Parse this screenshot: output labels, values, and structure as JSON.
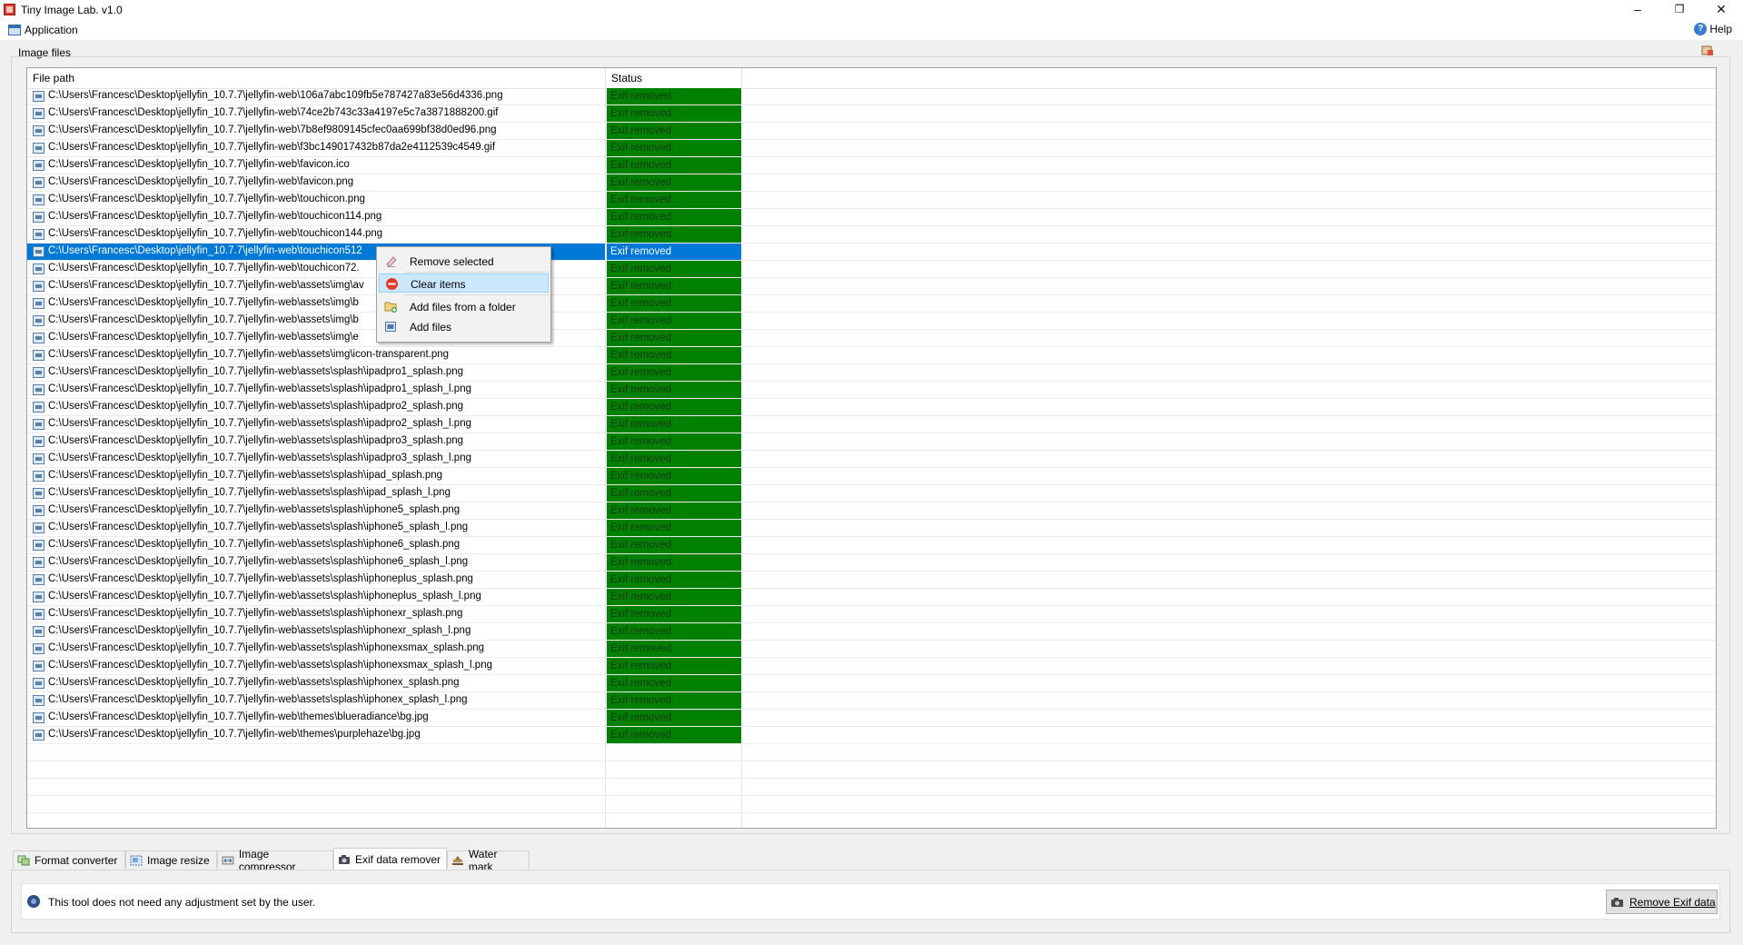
{
  "window": {
    "title": "Tiny Image Lab. v1.0",
    "minimize": "–",
    "maximize": "❐",
    "close": "✕"
  },
  "menubar": {
    "application": "Application",
    "help": "Help",
    "help_glyph": "?"
  },
  "group_label": "Image files",
  "table": {
    "columns": [
      "File path",
      "Status"
    ],
    "selected_index": 9,
    "rows": [
      {
        "path": "C:\\Users\\Francesc\\Desktop\\jellyfin_10.7.7\\jellyfin-web\\106a7abc109fb5e787427a83e56d4336.png",
        "status": "Exif removed"
      },
      {
        "path": "C:\\Users\\Francesc\\Desktop\\jellyfin_10.7.7\\jellyfin-web\\74ce2b743c33a4197e5c7a3871888200.gif",
        "status": "Exif removed"
      },
      {
        "path": "C:\\Users\\Francesc\\Desktop\\jellyfin_10.7.7\\jellyfin-web\\7b8ef9809145cfec0aa699bf38d0ed96.png",
        "status": "Exif removed"
      },
      {
        "path": "C:\\Users\\Francesc\\Desktop\\jellyfin_10.7.7\\jellyfin-web\\f3bc149017432b87da2e4112539c4549.gif",
        "status": "Exif removed"
      },
      {
        "path": "C:\\Users\\Francesc\\Desktop\\jellyfin_10.7.7\\jellyfin-web\\favicon.ico",
        "status": "Exif removed"
      },
      {
        "path": "C:\\Users\\Francesc\\Desktop\\jellyfin_10.7.7\\jellyfin-web\\favicon.png",
        "status": "Exif removed"
      },
      {
        "path": "C:\\Users\\Francesc\\Desktop\\jellyfin_10.7.7\\jellyfin-web\\touchicon.png",
        "status": "Exif removed"
      },
      {
        "path": "C:\\Users\\Francesc\\Desktop\\jellyfin_10.7.7\\jellyfin-web\\touchicon114.png",
        "status": "Exif removed"
      },
      {
        "path": "C:\\Users\\Francesc\\Desktop\\jellyfin_10.7.7\\jellyfin-web\\touchicon144.png",
        "status": "Exif removed"
      },
      {
        "path": "C:\\Users\\Francesc\\Desktop\\jellyfin_10.7.7\\jellyfin-web\\touchicon512",
        "status": "Exif removed"
      },
      {
        "path": "C:\\Users\\Francesc\\Desktop\\jellyfin_10.7.7\\jellyfin-web\\touchicon72.",
        "status": "Exif removed"
      },
      {
        "path": "C:\\Users\\Francesc\\Desktop\\jellyfin_10.7.7\\jellyfin-web\\assets\\img\\av",
        "status": "Exif removed"
      },
      {
        "path": "C:\\Users\\Francesc\\Desktop\\jellyfin_10.7.7\\jellyfin-web\\assets\\img\\b",
        "status": "Exif removed"
      },
      {
        "path": "C:\\Users\\Francesc\\Desktop\\jellyfin_10.7.7\\jellyfin-web\\assets\\img\\b",
        "status": "Exif removed"
      },
      {
        "path": "C:\\Users\\Francesc\\Desktop\\jellyfin_10.7.7\\jellyfin-web\\assets\\img\\e",
        "status": "Exif removed"
      },
      {
        "path": "C:\\Users\\Francesc\\Desktop\\jellyfin_10.7.7\\jellyfin-web\\assets\\img\\icon-transparent.png",
        "status": "Exif removed"
      },
      {
        "path": "C:\\Users\\Francesc\\Desktop\\jellyfin_10.7.7\\jellyfin-web\\assets\\splash\\ipadpro1_splash.png",
        "status": "Exif removed"
      },
      {
        "path": "C:\\Users\\Francesc\\Desktop\\jellyfin_10.7.7\\jellyfin-web\\assets\\splash\\ipadpro1_splash_l.png",
        "status": "Exif removed"
      },
      {
        "path": "C:\\Users\\Francesc\\Desktop\\jellyfin_10.7.7\\jellyfin-web\\assets\\splash\\ipadpro2_splash.png",
        "status": "Exif removed"
      },
      {
        "path": "C:\\Users\\Francesc\\Desktop\\jellyfin_10.7.7\\jellyfin-web\\assets\\splash\\ipadpro2_splash_l.png",
        "status": "Exif removed"
      },
      {
        "path": "C:\\Users\\Francesc\\Desktop\\jellyfin_10.7.7\\jellyfin-web\\assets\\splash\\ipadpro3_splash.png",
        "status": "Exif removed"
      },
      {
        "path": "C:\\Users\\Francesc\\Desktop\\jellyfin_10.7.7\\jellyfin-web\\assets\\splash\\ipadpro3_splash_l.png",
        "status": "Exif removed"
      },
      {
        "path": "C:\\Users\\Francesc\\Desktop\\jellyfin_10.7.7\\jellyfin-web\\assets\\splash\\ipad_splash.png",
        "status": "Exif removed"
      },
      {
        "path": "C:\\Users\\Francesc\\Desktop\\jellyfin_10.7.7\\jellyfin-web\\assets\\splash\\ipad_splash_l.png",
        "status": "Exif removed"
      },
      {
        "path": "C:\\Users\\Francesc\\Desktop\\jellyfin_10.7.7\\jellyfin-web\\assets\\splash\\iphone5_splash.png",
        "status": "Exif removed"
      },
      {
        "path": "C:\\Users\\Francesc\\Desktop\\jellyfin_10.7.7\\jellyfin-web\\assets\\splash\\iphone5_splash_l.png",
        "status": "Exif removed"
      },
      {
        "path": "C:\\Users\\Francesc\\Desktop\\jellyfin_10.7.7\\jellyfin-web\\assets\\splash\\iphone6_splash.png",
        "status": "Exif removed"
      },
      {
        "path": "C:\\Users\\Francesc\\Desktop\\jellyfin_10.7.7\\jellyfin-web\\assets\\splash\\iphone6_splash_l.png",
        "status": "Exif removed"
      },
      {
        "path": "C:\\Users\\Francesc\\Desktop\\jellyfin_10.7.7\\jellyfin-web\\assets\\splash\\iphoneplus_splash.png",
        "status": "Exif removed"
      },
      {
        "path": "C:\\Users\\Francesc\\Desktop\\jellyfin_10.7.7\\jellyfin-web\\assets\\splash\\iphoneplus_splash_l.png",
        "status": "Exif removed"
      },
      {
        "path": "C:\\Users\\Francesc\\Desktop\\jellyfin_10.7.7\\jellyfin-web\\assets\\splash\\iphonexr_splash.png",
        "status": "Exif removed"
      },
      {
        "path": "C:\\Users\\Francesc\\Desktop\\jellyfin_10.7.7\\jellyfin-web\\assets\\splash\\iphonexr_splash_l.png",
        "status": "Exif removed"
      },
      {
        "path": "C:\\Users\\Francesc\\Desktop\\jellyfin_10.7.7\\jellyfin-web\\assets\\splash\\iphonexsmax_splash.png",
        "status": "Exif removed"
      },
      {
        "path": "C:\\Users\\Francesc\\Desktop\\jellyfin_10.7.7\\jellyfin-web\\assets\\splash\\iphonexsmax_splash_l.png",
        "status": "Exif removed"
      },
      {
        "path": "C:\\Users\\Francesc\\Desktop\\jellyfin_10.7.7\\jellyfin-web\\assets\\splash\\iphonex_splash.png",
        "status": "Exif removed"
      },
      {
        "path": "C:\\Users\\Francesc\\Desktop\\jellyfin_10.7.7\\jellyfin-web\\assets\\splash\\iphonex_splash_l.png",
        "status": "Exif removed"
      },
      {
        "path": "C:\\Users\\Francesc\\Desktop\\jellyfin_10.7.7\\jellyfin-web\\themes\\blueradiance\\bg.jpg",
        "status": "Exif removed"
      },
      {
        "path": "C:\\Users\\Francesc\\Desktop\\jellyfin_10.7.7\\jellyfin-web\\themes\\purplehaze\\bg.jpg",
        "status": "Exif removed"
      }
    ]
  },
  "context_menu": {
    "items": [
      {
        "label": "Remove selected",
        "icon": "eraser-icon"
      },
      {
        "label": "Clear items",
        "icon": "no-entry-icon",
        "hovered": true
      },
      {
        "label": "Add files from a folder",
        "icon": "folder-add-icon"
      },
      {
        "label": "Add files",
        "icon": "add-image-icon"
      }
    ]
  },
  "tabs": [
    {
      "label": "Format converter",
      "icon": "convert-icon"
    },
    {
      "label": "Image resize",
      "icon": "resize-icon"
    },
    {
      "label": "Image compressor",
      "icon": "compress-icon"
    },
    {
      "label": "Exif data remover",
      "icon": "camera-icon",
      "active": true
    },
    {
      "label": "Water mark",
      "icon": "watermark-icon"
    }
  ],
  "info": {
    "text": "This tool does not need any adjustment set by the user."
  },
  "action_button": {
    "label": "Remove Exif data",
    "icon": "camera-icon"
  },
  "colors": {
    "status_ok": "#008000",
    "selection": "#0078d7",
    "menu_hover": "#cce8ff"
  }
}
